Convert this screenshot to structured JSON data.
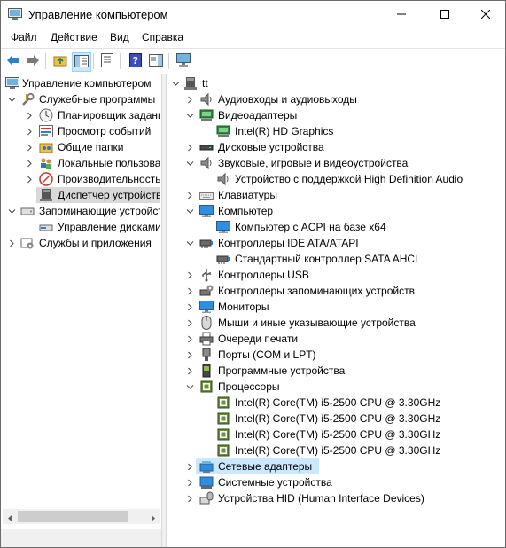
{
  "window": {
    "title": "Управление компьютером",
    "minimize_icon": "minimize-icon",
    "maximize_icon": "maximize-icon",
    "close_icon": "close-icon"
  },
  "menu": [
    "Файл",
    "Действие",
    "Вид",
    "Справка"
  ],
  "toolbar": {
    "buttons": [
      "back-arrow-icon",
      "forward-arrow-icon",
      "up-folder-icon",
      "show-hide-tree-icon",
      "properties-icon",
      "help-icon",
      "action-pane-icon",
      "monitor-icon"
    ]
  },
  "left_tree": {
    "root": "Управление компьютером",
    "system_tools": "Служебные программы",
    "task_scheduler": "Планировщик заданий",
    "event_viewer": "Просмотр событий",
    "shared_folders": "Общие папки",
    "local_users": "Локальные пользователи",
    "performance": "Производительность",
    "device_manager": "Диспетчер устройств",
    "storage": "Запоминающие устройства",
    "disk_management": "Управление дисками",
    "services": "Службы и приложения"
  },
  "right_tree": {
    "root": "tt",
    "items": [
      {
        "label": "Аудиовходы и аудиовыходы",
        "icon": "speaker-icon"
      },
      {
        "label": "Видеоадаптеры",
        "icon": "display-adapter-icon"
      },
      {
        "label": "Intel(R) HD Graphics",
        "icon": "display-adapter-icon"
      },
      {
        "label": "Дисковые устройства",
        "icon": "disk-drive-icon"
      },
      {
        "label": "Звуковые, игровые и видеоустройства",
        "icon": "speaker-icon"
      },
      {
        "label": "Устройство с поддержкой High Definition Audio",
        "icon": "speaker-icon"
      },
      {
        "label": "Клавиатуры",
        "icon": "keyboard-icon"
      },
      {
        "label": "Компьютер",
        "icon": "monitor-icon"
      },
      {
        "label": "Компьютер с ACPI на базе x64",
        "icon": "monitor-icon"
      },
      {
        "label": "Контроллеры IDE ATA/ATAPI",
        "icon": "ide-controller-icon"
      },
      {
        "label": "Стандартный контроллер SATA AHCI",
        "icon": "ide-controller-icon"
      },
      {
        "label": "Контроллеры USB",
        "icon": "usb-icon"
      },
      {
        "label": "Контроллеры запоминающих устройств",
        "icon": "storage-controller-icon"
      },
      {
        "label": "Мониторы",
        "icon": "monitor-icon"
      },
      {
        "label": "Мыши и иные указывающие устройства",
        "icon": "mouse-icon"
      },
      {
        "label": "Очереди печати",
        "icon": "printer-icon"
      },
      {
        "label": "Порты (COM и LPT)",
        "icon": "port-icon"
      },
      {
        "label": "Программные устройства",
        "icon": "software-device-icon"
      },
      {
        "label": "Процессоры",
        "icon": "processor-icon"
      },
      {
        "label": "Intel(R) Core(TM) i5-2500 CPU @ 3.30GHz",
        "icon": "processor-icon"
      },
      {
        "label": "Intel(R) Core(TM) i5-2500 CPU @ 3.30GHz",
        "icon": "processor-icon"
      },
      {
        "label": "Intel(R) Core(TM) i5-2500 CPU @ 3.30GHz",
        "icon": "processor-icon"
      },
      {
        "label": "Intel(R) Core(TM) i5-2500 CPU @ 3.30GHz",
        "icon": "processor-icon"
      },
      {
        "label": "Сетевые адаптеры",
        "icon": "network-adapter-icon"
      },
      {
        "label": "Системные устройства",
        "icon": "system-device-icon"
      },
      {
        "label": "Устройства HID (Human Interface Devices)",
        "icon": "hid-icon"
      }
    ]
  },
  "colors": {
    "selection": "#cce8ff",
    "inactive_selection": "#d9d9d9"
  }
}
